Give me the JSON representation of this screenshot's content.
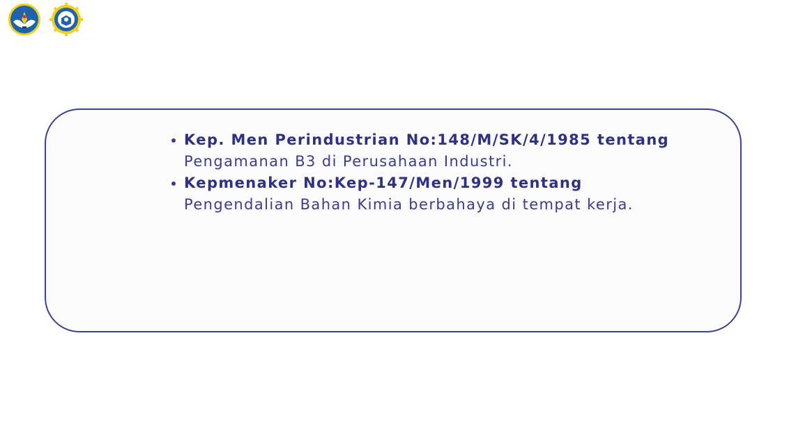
{
  "logos": [
    {
      "icon": "tut-wuri-handayani-emblem-icon"
    },
    {
      "icon": "school-crest-gear-emblem-icon"
    }
  ],
  "colors": {
    "accent": "#3d4096",
    "text": "#3a3d8c",
    "box_background": "#fcfbfb",
    "logo_gold": "#f2cf1d"
  },
  "content": {
    "items": [
      {
        "bold": "Kep. Men Perindustrian No:148/M/SK/4/1985 tentang",
        "text": "Pengamanan B3 di Perusahaan Industri."
      },
      {
        "bold": "Kepmenaker No:Kep-147/Men/1999 tentang",
        "text": "Pengendalian Bahan Kimia berbahaya di tempat kerja."
      }
    ]
  }
}
